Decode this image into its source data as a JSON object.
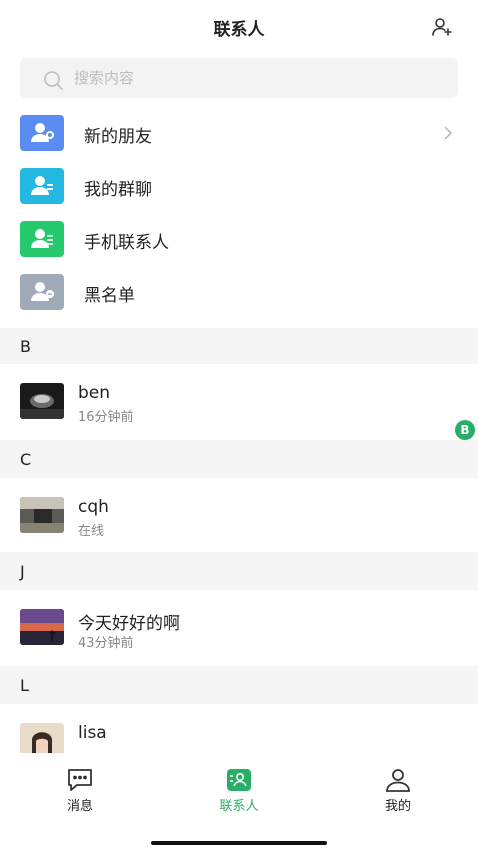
{
  "header": {
    "title": "联系人",
    "add_icon": "add-user-icon"
  },
  "search": {
    "placeholder": "搜索内容",
    "value": ""
  },
  "quick_actions": [
    {
      "label": "新的朋友",
      "icon": "new-friends-icon",
      "color": "#5a8cf2"
    },
    {
      "label": "我的群聊",
      "icon": "group-chat-icon",
      "color": "#23b8e0"
    },
    {
      "label": "手机联系人",
      "icon": "phone-contacts-icon",
      "color": "#27c96e"
    },
    {
      "label": "黑名单",
      "icon": "blacklist-icon",
      "color": "#a1aab8"
    }
  ],
  "sections": [
    {
      "letter": "B",
      "contacts": [
        {
          "name": "ben",
          "status": "16分钟前"
        }
      ]
    },
    {
      "letter": "C",
      "contacts": [
        {
          "name": "cqh",
          "status": "在线"
        }
      ]
    },
    {
      "letter": "J",
      "contacts": [
        {
          "name": "今天好好的啊",
          "status": "43分钟前"
        }
      ]
    },
    {
      "letter": "L",
      "contacts": [
        {
          "name": "lisa",
          "status": ""
        }
      ]
    }
  ],
  "index_badge": "B",
  "tabs": [
    {
      "label": "消息",
      "icon": "chat-bubble-icon",
      "active": false
    },
    {
      "label": "联系人",
      "icon": "contacts-icon",
      "active": true
    },
    {
      "label": "我的",
      "icon": "person-icon",
      "active": false
    }
  ],
  "colors": {
    "accent": "#2aae67",
    "section_bg": "#f5f5f5"
  }
}
